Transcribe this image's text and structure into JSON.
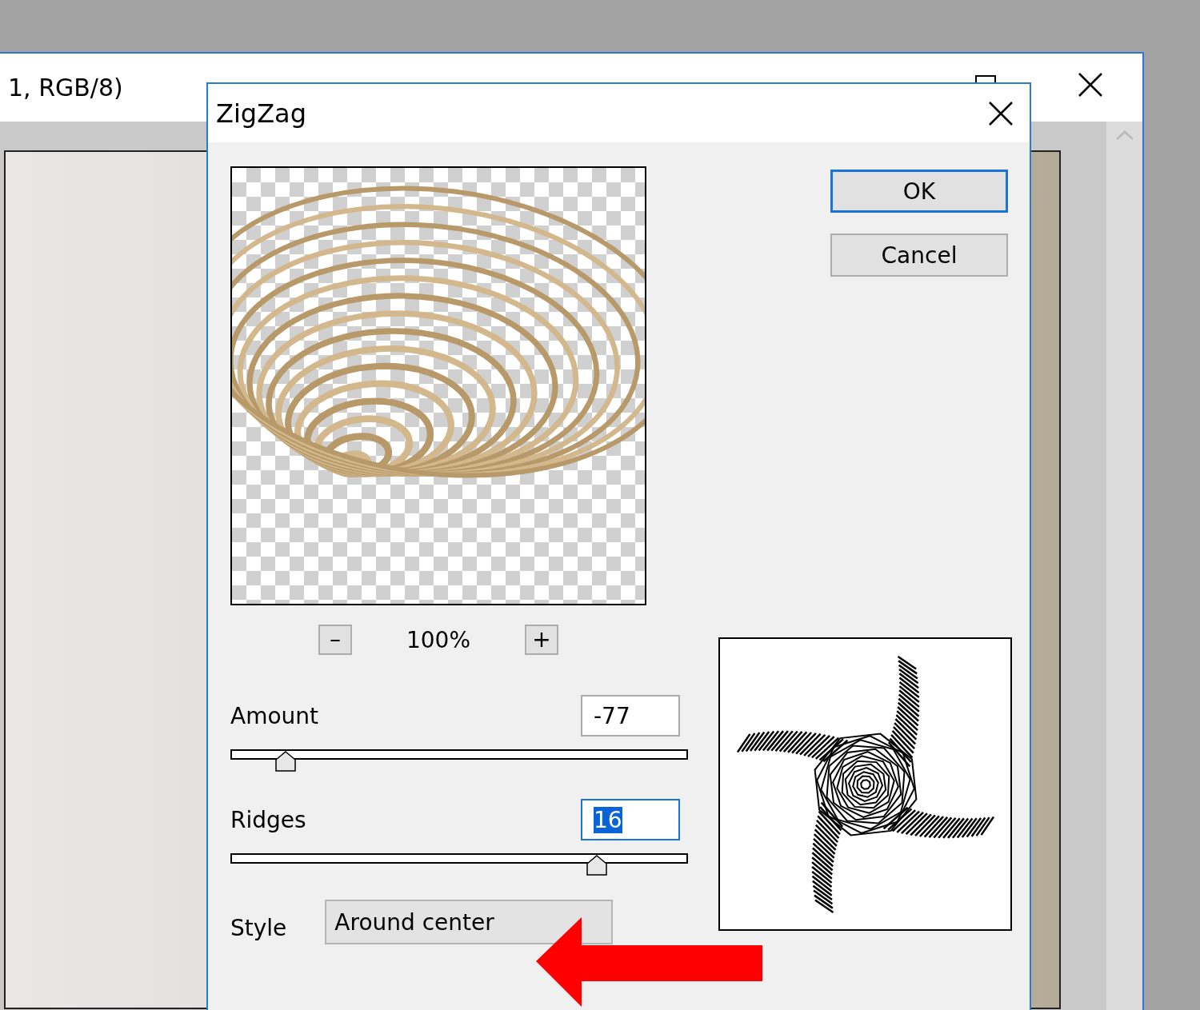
{
  "background_window": {
    "title": "1, RGB/8)"
  },
  "dialog": {
    "title": "ZigZag",
    "buttons": [
      {
        "label": "OK",
        "default": true
      },
      {
        "label": "Cancel",
        "default": false
      }
    ],
    "zoom": {
      "minus": "–",
      "level": "100%",
      "plus": "+"
    },
    "controls": [
      {
        "kind": "slider",
        "label": "Amount",
        "value": "-77",
        "level": 0.12,
        "focused": false
      },
      {
        "kind": "slider",
        "label": "Ridges",
        "value": "16",
        "level": 0.8,
        "focused": true
      },
      {
        "kind": "dropdown",
        "label": "Style",
        "value": "Around center"
      }
    ]
  }
}
